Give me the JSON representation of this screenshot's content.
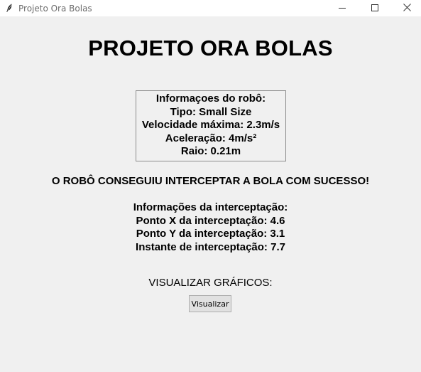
{
  "window": {
    "title": "Projeto Ora Bolas",
    "icon": "feather-icon",
    "controls": [
      "minimize-icon",
      "maximize-icon",
      "close-icon"
    ]
  },
  "main": {
    "title": "PROJETO ORA BOLAS",
    "robot_info": {
      "header": "Informaçoes do robô:",
      "type": "Tipo: Small Size",
      "max_speed": "Velocidade máxima: 2.3m/s",
      "acceleration": "Aceleração: 4m/s²",
      "radius": "Raio: 0.21m"
    },
    "success_message": "O ROBÔ CONSEGUIU INTERCEPTAR A BOLA COM SUCESSO!",
    "interception": {
      "header": "Informações da interceptação:",
      "point_x": "Ponto X da interceptação: 4.6",
      "point_y": "Ponto Y da interceptação: 3.1",
      "instant": "Instante de interceptação: 7.7"
    },
    "charts": {
      "label": "VISUALIZAR GRÁFICOS:",
      "button_label": "Visualizar"
    }
  }
}
